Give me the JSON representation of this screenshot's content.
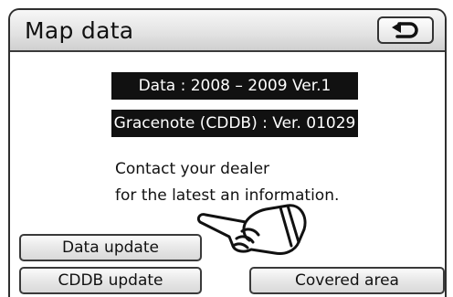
{
  "header": {
    "title": "Map data",
    "back_icon": "return-arrow-icon"
  },
  "versions": {
    "data": "Data : 2008 – 2009 Ver.1",
    "cddb": "Gracenote (CDDB) : Ver. 01029"
  },
  "message": {
    "line1": "Contact your dealer",
    "line2": "for the latest   an  information."
  },
  "buttons": {
    "data_update": "Data update",
    "cddb_update": "CDDB update",
    "covered_area": "Covered area"
  },
  "colors": {
    "header_bg": "#e2e2e2",
    "version_box_bg": "#111111",
    "version_text": "#ffffff"
  }
}
